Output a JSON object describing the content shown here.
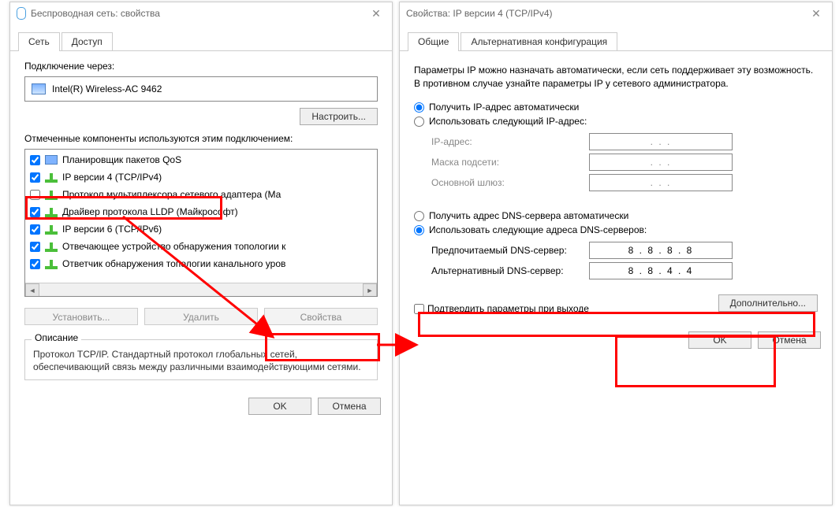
{
  "left": {
    "title": "Беспроводная сеть: свойства",
    "tabs": {
      "network": "Сеть",
      "access": "Доступ"
    },
    "connect_via_label": "Подключение через:",
    "adapter": "Intel(R) Wireless-AC 9462",
    "configure": "Настроить...",
    "components_label": "Отмеченные компоненты используются этим подключением:",
    "components": [
      {
        "label": "Планировщик пакетов QoS",
        "checked": true,
        "iconType": "monitor"
      },
      {
        "label": "IP версии 4 (TCP/IPv4)",
        "checked": true,
        "iconType": "green"
      },
      {
        "label": "Протокол мультиплексора сетевого адаптера (Ма",
        "checked": false,
        "iconType": "green"
      },
      {
        "label": "Драйвер протокола LLDP (Майкрософт)",
        "checked": true,
        "iconType": "green"
      },
      {
        "label": "IP версии 6 (TCP/IPv6)",
        "checked": true,
        "iconType": "green"
      },
      {
        "label": "Отвечающее устройство обнаружения топологии к",
        "checked": true,
        "iconType": "green"
      },
      {
        "label": "Ответчик обнаружения топологии канального уров",
        "checked": true,
        "iconType": "green"
      }
    ],
    "install": "Установить...",
    "remove": "Удалить",
    "properties": "Свойства",
    "description_caption": "Описание",
    "description": "Протокол TCP/IP. Стандартный протокол глобальных сетей, обеспечивающий связь между различными взаимодействующими сетями.",
    "ok": "OK",
    "cancel": "Отмена"
  },
  "right": {
    "title": "Свойства: IP версии 4 (TCP/IPv4)",
    "tabs": {
      "general": "Общие",
      "alt": "Альтернативная конфигурация"
    },
    "info": "Параметры IP можно назначать автоматически, если сеть поддерживает эту возможность. В противном случае узнайте параметры IP у сетевого администратора.",
    "ip_auto": "Получить IP-адрес автоматически",
    "ip_manual": "Использовать следующий IP-адрес:",
    "ip_fields": {
      "ip": "IP-адрес:",
      "mask": "Маска подсети:",
      "gateway": "Основной шлюз:"
    },
    "dns_auto": "Получить адрес DNS-сервера автоматически",
    "dns_manual": "Использовать следующие адреса DNS-серверов:",
    "dns_fields": {
      "preferred_label": "Предпочитаемый DNS-сервер:",
      "preferred_value": "8 . 8 . 8 . 8",
      "alternate_label": "Альтернативный DNS-сервер:",
      "alternate_value": "8 . 8 . 4 . 4"
    },
    "confirm_exit": "Подтвердить параметры при выходе",
    "advanced": "Дополнительно...",
    "ok": "OK",
    "cancel": "Отмена"
  },
  "ip_dots": ".     .     ."
}
